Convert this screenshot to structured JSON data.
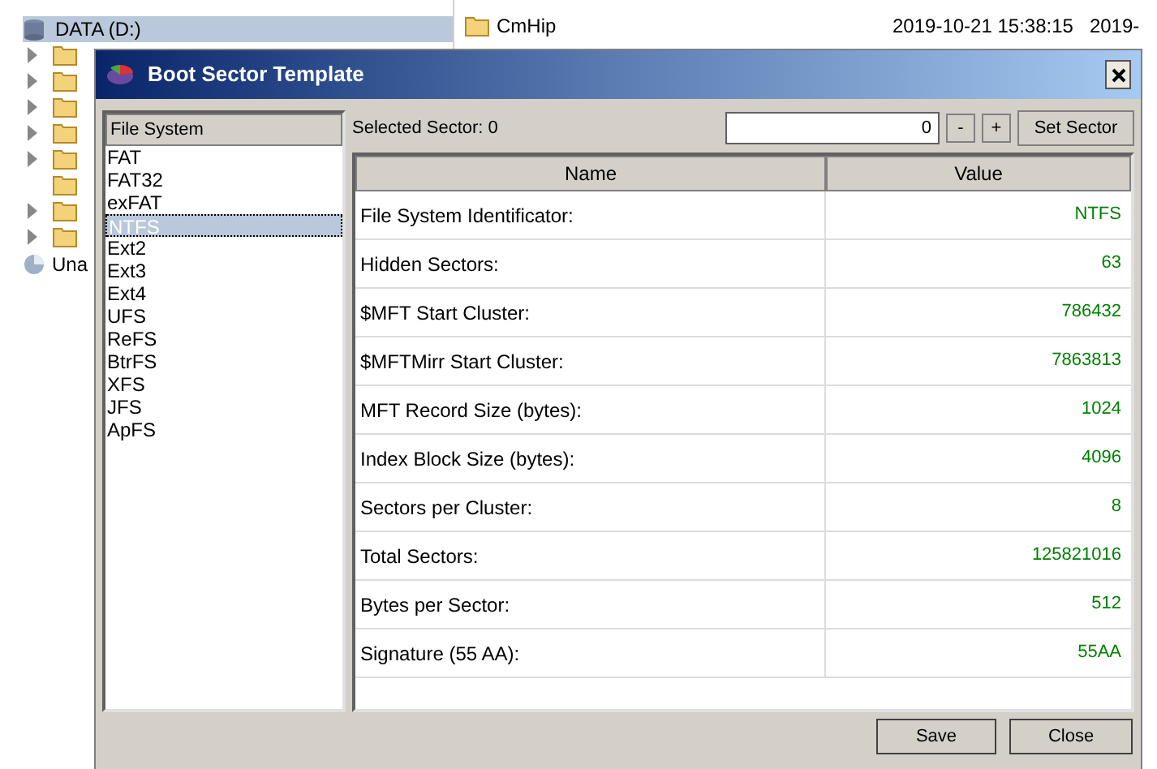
{
  "tree": {
    "drive": {
      "label": "DATA (D:)",
      "selected": true
    },
    "folders": [
      {
        "expandable": true
      },
      {
        "expandable": true
      },
      {
        "expandable": true
      },
      {
        "expandable": true
      },
      {
        "expandable": true
      },
      {
        "expandable": false
      },
      {
        "expandable": true
      },
      {
        "expandable": true
      }
    ],
    "unallocated": {
      "label": "Una"
    }
  },
  "file_list": {
    "name": "CmHip",
    "column_2": "2019-10-21 15:38:15",
    "column_3": "2019-"
  },
  "dialog": {
    "title": "Boot Sector Template",
    "file_systems": {
      "header": "File System",
      "items": [
        {
          "label": "FAT",
          "selected": false
        },
        {
          "label": "FAT32",
          "selected": false
        },
        {
          "label": "exFAT",
          "selected": false
        },
        {
          "label": "NTFS",
          "selected": true
        },
        {
          "label": "Ext2",
          "selected": false
        },
        {
          "label": "Ext3",
          "selected": false
        },
        {
          "label": "Ext4",
          "selected": false
        },
        {
          "label": "UFS",
          "selected": false
        },
        {
          "label": "ReFS",
          "selected": false
        },
        {
          "label": "BtrFS",
          "selected": false
        },
        {
          "label": "XFS",
          "selected": false
        },
        {
          "label": "JFS",
          "selected": false
        },
        {
          "label": "ApFS",
          "selected": false
        }
      ]
    },
    "selected_sector": "Selected Sector: 0",
    "sector_value": "0",
    "minus": "-",
    "plus": "+",
    "set_sector": "Set Sector",
    "table": {
      "columns": [
        "Name",
        "Value"
      ],
      "rows": [
        [
          "File System Identificator:",
          "NTFS"
        ],
        [
          "Hidden Sectors:",
          "63"
        ],
        [
          "$MFT Start Cluster:",
          "786432"
        ],
        [
          "$MFTMirr Start Cluster:",
          "7863813"
        ],
        [
          "MFT Record Size (bytes):",
          "1024"
        ],
        [
          "Index Block Size (bytes):",
          "4096"
        ],
        [
          "Sectors per Cluster:",
          "8"
        ],
        [
          "Total Sectors:",
          "125821016"
        ],
        [
          "Bytes per Sector:",
          "512"
        ],
        [
          "Signature (55 AA):",
          "55AA"
        ]
      ]
    },
    "buttons": [
      "Save",
      "Close"
    ]
  }
}
